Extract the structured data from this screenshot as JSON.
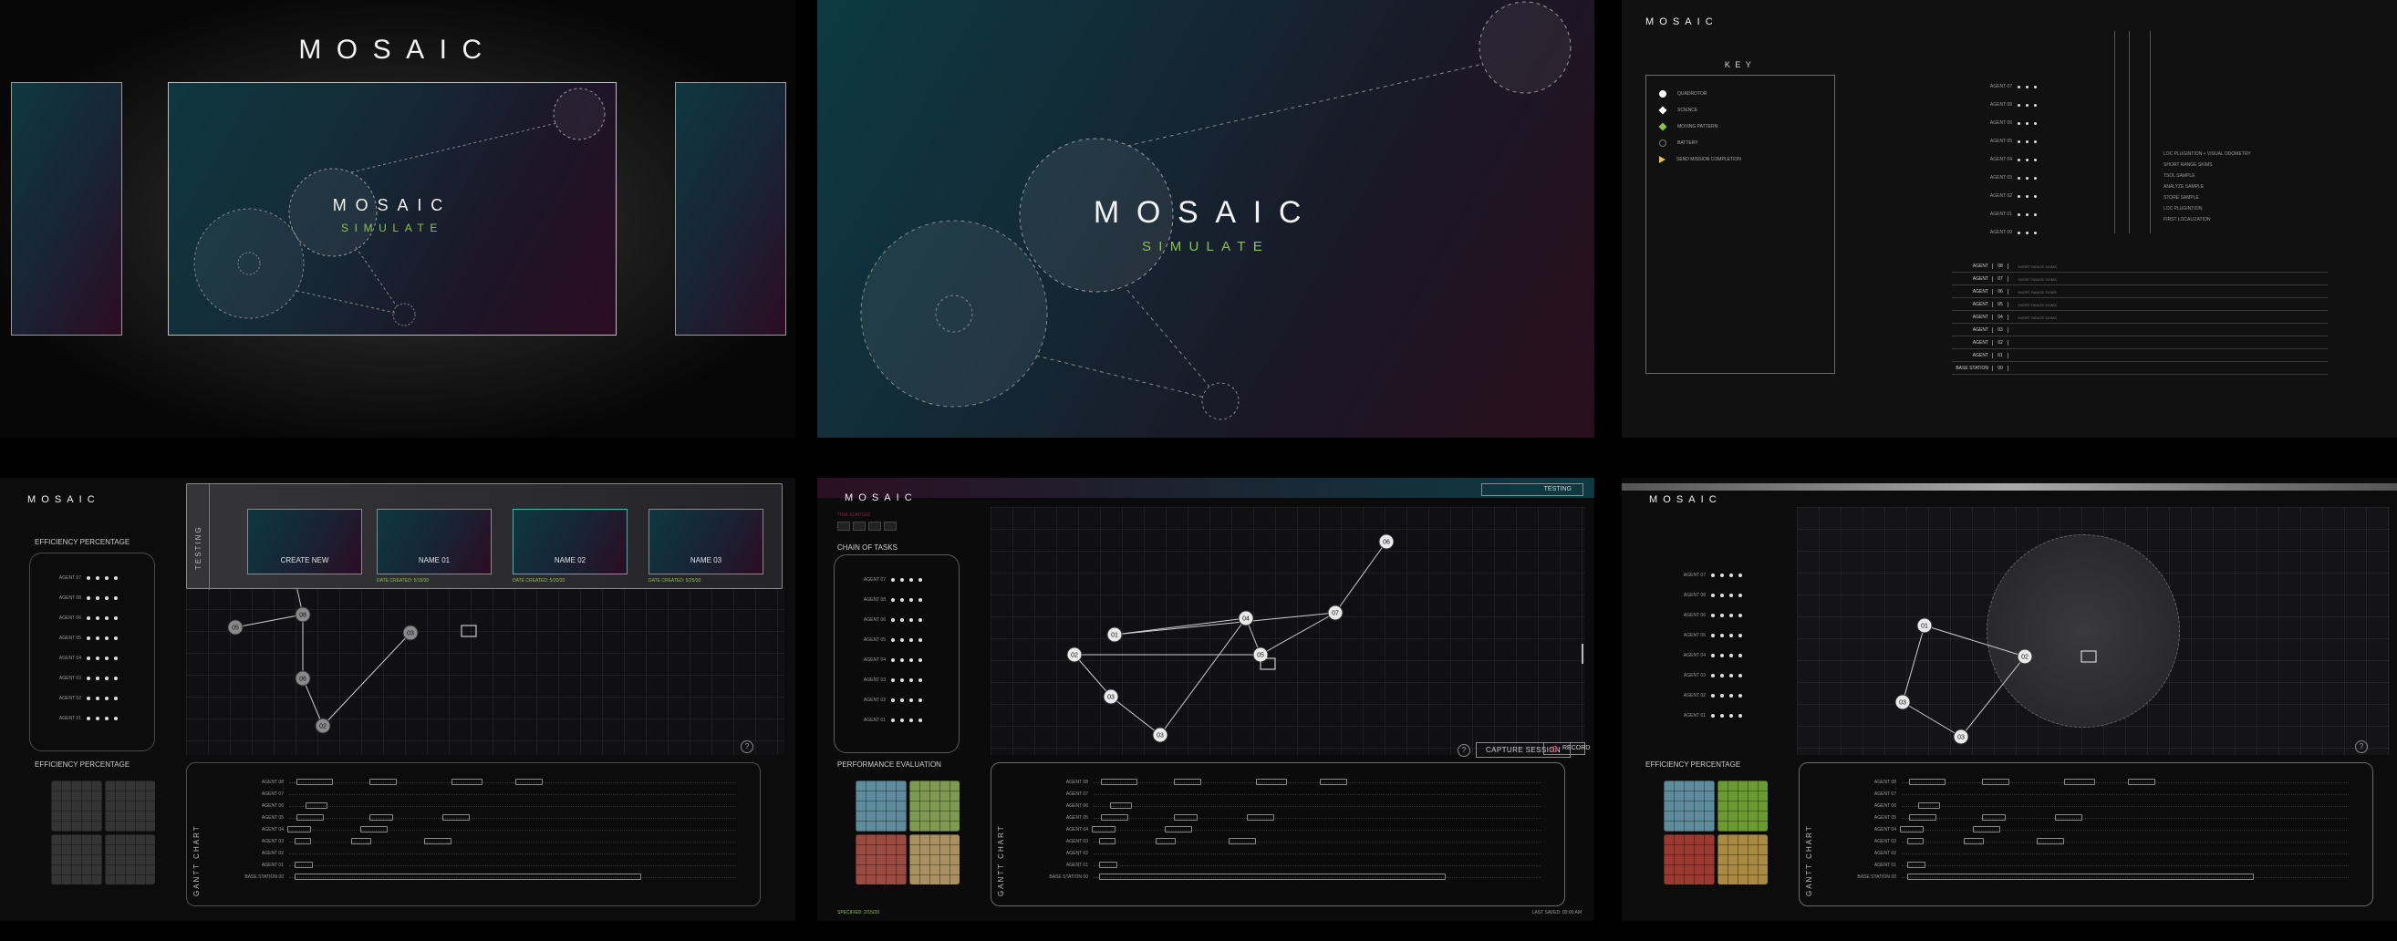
{
  "brand": {
    "logo": "MOSAIC",
    "subtitle": "SIMULATE"
  },
  "panel3": {
    "key_title": "KEY",
    "key_items": [
      {
        "label": "QUADROTOR",
        "icon": "circle-icon",
        "color": "#ffffff"
      },
      {
        "label": "SCIENCE",
        "icon": "diamond-icon",
        "color": "#ffffff"
      },
      {
        "label": "MOVING PATTERN",
        "icon": "diamond-icon",
        "color": "#8bc34a"
      },
      {
        "label": "BATTERY",
        "icon": "circle-outline-icon",
        "color": "#777777"
      },
      {
        "label": "SEND MISSION COMPLETION",
        "icon": "triangle-icon",
        "color": "#f0c030"
      }
    ],
    "agents": [
      "AGENT 07",
      "AGENT 08",
      "AGENT 06",
      "AGENT 05",
      "AGENT 04",
      "AGENT 03",
      "AGENT 02",
      "AGENT 01",
      "AGENT 00"
    ],
    "tasks": [
      "LOC PLUGINTION + VISUAL ODOMETRY",
      "SHORT RANGE SKIMS",
      "TSOL SAMPLE",
      "ANALYZE SAMPLE",
      "STORE SAMPLE",
      "LOC PLUGINTION",
      "FIRST LOCALIZATION"
    ],
    "table_rows": [
      {
        "name": "AGENT",
        "id": "08",
        "desc": "SHORT RANGE SKIMS"
      },
      {
        "name": "AGENT",
        "id": "07",
        "desc": "SHORT RANGE SKIMS"
      },
      {
        "name": "AGENT",
        "id": "06",
        "desc": "SHORT RANGE SKIMS"
      },
      {
        "name": "AGENT",
        "id": "05",
        "desc": "SHORT RANGE SKIMS"
      },
      {
        "name": "AGENT",
        "id": "04",
        "desc": "SHORT RANGE SKIMS"
      },
      {
        "name": "AGENT",
        "id": "03",
        "desc": ""
      },
      {
        "name": "AGENT",
        "id": "02",
        "desc": ""
      },
      {
        "name": "AGENT",
        "id": "01",
        "desc": ""
      },
      {
        "name": "BASE STATION",
        "id": "00",
        "desc": ""
      }
    ]
  },
  "panel4": {
    "top_label": "EFFICIENCY PERCENTAGE",
    "bottom_label": "EFFICIENCY PERCENTAGE",
    "side_tab": "TESTING",
    "scenarios": [
      {
        "name": "CREATE NEW",
        "sub": ""
      },
      {
        "name": "NAME 01",
        "sub": "DATE CREATED: 5/15/20"
      },
      {
        "name": "NAME 02",
        "sub": "DATE CREATED: 5/20/20"
      },
      {
        "name": "NAME 03",
        "sub": "DATE CREATED: 5/25/20"
      }
    ],
    "gantt_title": "GANTT CHART",
    "nodes": [
      "05",
      "08",
      "06",
      "02",
      "03",
      "01"
    ]
  },
  "panel5": {
    "tab": "TESTING",
    "small_label": "TIME ELAPSED",
    "chain_label": "CHAIN OF TASKS",
    "perf_label": "PERFORMANCE EVALUATION",
    "capture": "CAPTURE SESSION",
    "record": "RECORD",
    "footer_left": "SPECIFIED: 2/15/20",
    "footer_right": "LAST SAVED: 00:00 AM",
    "gantt_title": "GANTT CHART",
    "nodes": [
      "06",
      "07",
      "01",
      "04",
      "05",
      "02",
      "03",
      "03"
    ]
  },
  "panel6": {
    "bottom_label": "EFFICIENCY PERCENTAGE",
    "gantt_title": "GANTT CHART",
    "nodes": [
      "01",
      "02",
      "03",
      "03"
    ]
  },
  "gantt_rows": [
    "AGENT 08",
    "AGENT 07",
    "AGENT 06",
    "AGENT 05",
    "AGENT 04",
    "AGENT 03",
    "AGENT 02",
    "AGENT 01",
    "BASE STATION 00"
  ],
  "side_agents": [
    "AGENT 07",
    "AGENT 08",
    "AGENT 06",
    "AGENT 05",
    "AGENT 04",
    "AGENT 03",
    "AGENT 02",
    "AGENT 01"
  ]
}
